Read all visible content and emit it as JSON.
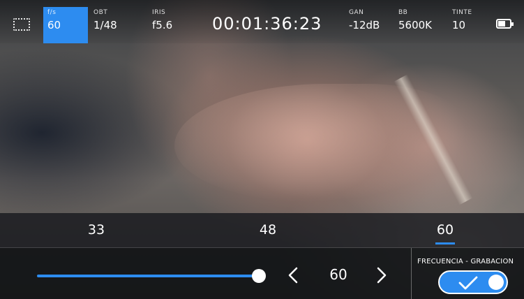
{
  "top_bar": {
    "params": [
      {
        "label": "f/s",
        "value": "60"
      },
      {
        "label": "OBT",
        "value": "1/48"
      },
      {
        "label": "IRIS",
        "value": "f5.6"
      },
      {
        "label": "GAN",
        "value": "-12dB"
      },
      {
        "label": "BB",
        "value": "5600K"
      },
      {
        "label": "TINTE",
        "value": "10"
      }
    ],
    "timecode": "00:01:36:23",
    "battery_level": 0.6
  },
  "presets": {
    "items": [
      "33",
      "48",
      "60"
    ],
    "selected": "60"
  },
  "controls": {
    "slider_fraction": 1.0,
    "stepper_value": "60",
    "toggle_label": "FRECUENCIA - GRABACIÓN",
    "toggle_on": true
  },
  "colors": {
    "accent": "#2d8cf0"
  }
}
